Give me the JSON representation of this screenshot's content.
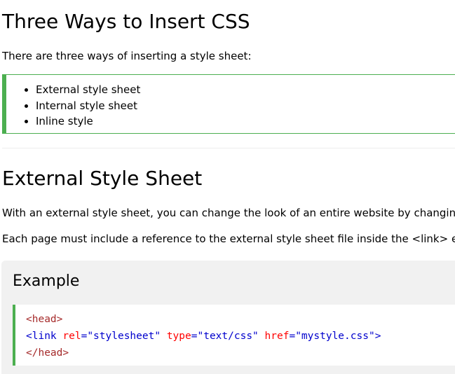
{
  "section1": {
    "title": "Three Ways to Insert CSS",
    "intro": "There are three ways of inserting a style sheet:",
    "list": [
      "External style sheet",
      "Internal style sheet",
      "Inline style"
    ]
  },
  "section2": {
    "title": "External Style Sheet",
    "p1": "With an external style sheet, you can change the look of an entire website by changin",
    "p2": "Each page must include a reference to the external style sheet file inside the <link> e"
  },
  "example": {
    "title": "Example",
    "code": {
      "line1_tag": "<head>",
      "line2_open": "<link ",
      "line2_attr1": "rel",
      "line2_eq1": "=",
      "line2_val1": "\"stylesheet\"",
      "line2_sp1": " ",
      "line2_attr2": "type",
      "line2_eq2": "=",
      "line2_val2": "\"text/css\"",
      "line2_sp2": " ",
      "line2_attr3": "href",
      "line2_eq3": "=",
      "line2_val3": "\"mystyle.css\"",
      "line2_close": ">",
      "line3_tag": "</head>"
    }
  },
  "colors": {
    "accent": "#4CAF50",
    "example_bg": "#f1f1f1",
    "tag": "#0000cd",
    "attr": "#ff0000"
  }
}
